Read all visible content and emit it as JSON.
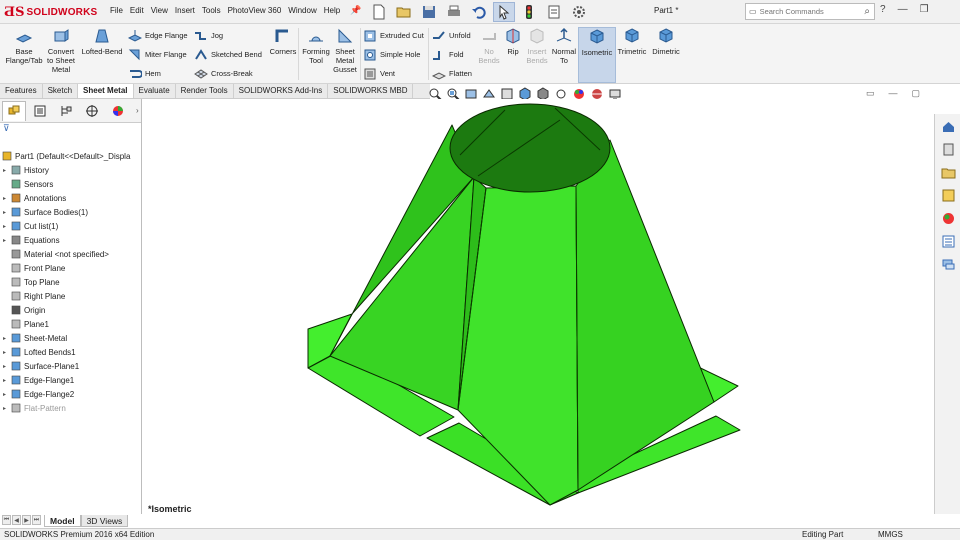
{
  "app": {
    "logo_text": "SOLIDWORKS",
    "document_title": "Part1 *"
  },
  "menu": [
    "File",
    "Edit",
    "View",
    "Insert",
    "Tools",
    "PhotoView 360",
    "Window",
    "Help"
  ],
  "search": {
    "placeholder": "Search Commands"
  },
  "ribbon": {
    "base_flange": "Base\nFlange/Tab",
    "convert": "Convert\nto Sheet\nMetal",
    "lofted_bend": "Lofted-Bend",
    "edge_flange": "Edge Flange",
    "miter_flange": "Miter Flange",
    "hem": "Hem",
    "jog": "Jog",
    "sketched_bend": "Sketched Bend",
    "cross_break": "Cross-Break",
    "corners": "Corners",
    "forming_tool": "Forming\nTool",
    "sheet_metal_gusset": "Sheet\nMetal\nGusset",
    "extruded_cut": "Extruded Cut",
    "simple_hole": "Simple Hole",
    "vent": "Vent",
    "unfold": "Unfold",
    "fold": "Fold",
    "flatten": "Flatten",
    "no_bends": "No\nBends",
    "rip": "Rip",
    "insert_bends": "Insert\nBends",
    "normal_to": "Normal\nTo",
    "isometric": "Isometric",
    "trimetric": "Trimetric",
    "dimetric": "Dimetric"
  },
  "command_tabs": [
    "Features",
    "Sketch",
    "Sheet Metal",
    "Evaluate",
    "Render Tools",
    "SOLIDWORKS Add-Ins",
    "SOLIDWORKS MBD"
  ],
  "active_command_tab": "Sheet Metal",
  "tree": {
    "root": "Part1  (Default<<Default>_Displa",
    "items": [
      {
        "label": "History",
        "icon": "history-icon",
        "expandable": true
      },
      {
        "label": "Sensors",
        "icon": "sensors-icon",
        "expandable": false
      },
      {
        "label": "Annotations",
        "icon": "annotations-icon",
        "expandable": true
      },
      {
        "label": "Surface Bodies(1)",
        "icon": "surface-bodies-icon",
        "expandable": true
      },
      {
        "label": "Cut list(1)",
        "icon": "cut-list-icon",
        "expandable": true
      },
      {
        "label": "Equations",
        "icon": "equations-icon",
        "expandable": true
      },
      {
        "label": "Material <not specified>",
        "icon": "material-icon",
        "expandable": false
      },
      {
        "label": "Front Plane",
        "icon": "plane-icon",
        "expandable": false
      },
      {
        "label": "Top Plane",
        "icon": "plane-icon",
        "expandable": false
      },
      {
        "label": "Right Plane",
        "icon": "plane-icon",
        "expandable": false
      },
      {
        "label": "Origin",
        "icon": "origin-icon",
        "expandable": false
      },
      {
        "label": "Plane1",
        "icon": "plane-icon",
        "expandable": false
      },
      {
        "label": "Sheet-Metal",
        "icon": "sheet-metal-icon",
        "expandable": true
      },
      {
        "label": "Lofted Bends1",
        "icon": "lofted-bends-icon",
        "expandable": true
      },
      {
        "label": "Surface-Plane1",
        "icon": "surface-plane-icon",
        "expandable": true
      },
      {
        "label": "Edge-Flange1",
        "icon": "edge-flange-icon",
        "expandable": true
      },
      {
        "label": "Edge-Flange2",
        "icon": "edge-flange-icon",
        "expandable": true
      },
      {
        "label": "Flat-Pattern",
        "icon": "flat-pattern-icon",
        "expandable": true,
        "suppressed": true
      }
    ]
  },
  "bottom_tabs": [
    "Model",
    "3D Views"
  ],
  "active_bottom_tab": "Model",
  "view_name": "*Isometric",
  "status": {
    "edition": "SOLIDWORKS Premium 2016 x64 Edition",
    "mode": "Editing Part",
    "units": "MMGS"
  },
  "colors": {
    "model_green": "#33dd22",
    "brand_red": "#d0021b",
    "accent_blue": "#3a6db5"
  }
}
